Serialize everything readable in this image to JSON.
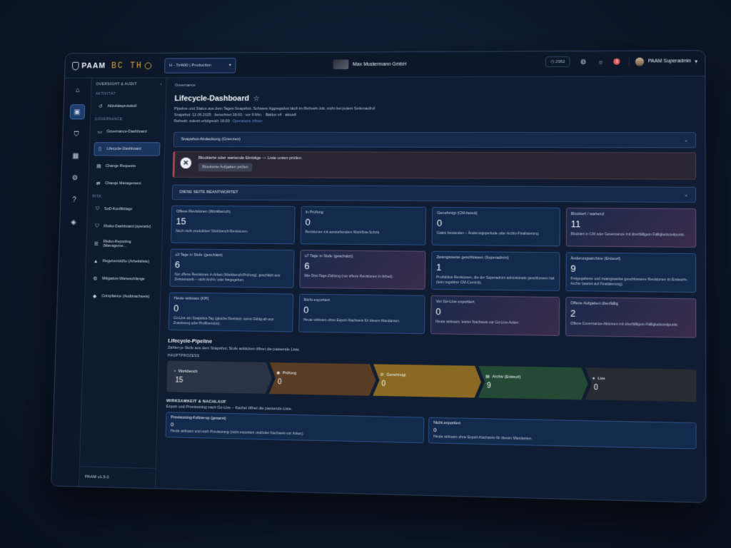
{
  "app": {
    "brand": "PAAM",
    "client_logo": "BC TH",
    "environment": "H - 7z4t00 | Production",
    "company": "Max Mustermann GmbH",
    "counter": "2952",
    "notifications": "3",
    "user": "PAAM Superadmin",
    "version": "PAAM v1.5.0"
  },
  "sidebar": {
    "header": "OVERSIGHT & AUDIT",
    "sections": [
      {
        "title": "AKTIVITÄT",
        "items": [
          {
            "label": "Aktivitätsprotokoll",
            "icon": "history-icon"
          }
        ]
      },
      {
        "title": "GOVERNANCE",
        "items": [
          {
            "label": "Governance-Dashboard",
            "icon": "monitor-icon"
          },
          {
            "label": "Lifecycle-Dashboard",
            "icon": "document-icon",
            "active": true
          },
          {
            "label": "Change Requests",
            "icon": "clipboard-icon"
          },
          {
            "label": "Change Management",
            "icon": "swap-icon"
          }
        ]
      },
      {
        "title": "RISK",
        "items": [
          {
            "label": "SoD-Konfliktlage",
            "icon": "shield-icon"
          },
          {
            "label": "Risiko-Dashboard (operativ)",
            "icon": "shield-icon"
          },
          {
            "label": "Risiko-Reporting (Manageme...",
            "icon": "list-icon"
          },
          {
            "label": "Regelverstöße (Arbeitsliste)",
            "icon": "warning-icon"
          },
          {
            "label": "Mitigation-Warteschlange",
            "icon": "gear-icon"
          },
          {
            "label": "Compliance (Auditnachweis)",
            "icon": "graduation-icon"
          }
        ]
      }
    ]
  },
  "main": {
    "breadcrumb": "Governance",
    "title": "Lifecycle-Dashboard",
    "subtitle1": "Pipeline und Status aus dem Tages-Snapshot. Schwere Aggregation läuft im Refresh-Job, nicht bei jedem Seitenaufruf.",
    "subtitle2": "Snapshot: 12.06.2025 · berechnet 16:00 · vor 9 Min. · Baldor v4 · aktuell",
    "subtitle3": "Refresh: zuletzt erfolgreich 16:00",
    "subtitle3_link": "Operations öffnen",
    "accordion1": "Snapshot-Abdeckung (Grenzen)",
    "alert_text": "Blockierte oder wartende Einträge — Liste unten prüfen.",
    "alert_button": "Blockierte Aufgaben prüfen",
    "accordion2": "DIESE SEITE BEANTWORTET",
    "kpis": [
      {
        "label": "Offene Revisionen (Workbench)",
        "value": "15",
        "desc": "Noch nicht produktiver Workbench-Revisionen.",
        "tone": "blue"
      },
      {
        "label": "In Prüfung",
        "value": "0",
        "desc": "Revisionen mit ausstehendem Workflow-Schritt.",
        "tone": "blue"
      },
      {
        "label": "Genehmigt (CM-bereit)",
        "value": "0",
        "desc": "Gates bestanden – Änderungsperiode oder Archiv-Finalisierung.",
        "tone": "blue"
      },
      {
        "label": "Blockiert / wartend",
        "value": "11",
        "desc": "Blockiert in CM oder Governance mit überfälligem Fälligkeitszeitpunkt.",
        "tone": "red"
      },
      {
        "label": "≥3 Tage in Stufe (geschätzt)",
        "value": "6",
        "desc": "Nur offene Revisionen in Arbeit (Workbench/Prüfung), geschätzt aus Zeitstempeln – nicht Archiv oder freigegeben.",
        "tone": "blue"
      },
      {
        "label": "≥7 Tage in Stufe (geschätzt)",
        "value": "6",
        "desc": "Wie Drei-Tage-Zählung (nur offene Revisionen in Arbeit).",
        "tone": "red"
      },
      {
        "label": "Zwangsweise geschlossen (Superadmin)",
        "value": "1",
        "desc": "Produktive Revisionen, die der Superadmin administrativ geschlossen hat (kein regulärer CM-Commit).",
        "tone": "blue"
      },
      {
        "label": "Änderungsarchive (Entwurf)",
        "value": "9",
        "desc": "Freigegebene und zwangsweise geschlossene Revisionen im Entwurfs-Archiv (wartet auf Finalisierung).",
        "tone": "blue"
      },
      {
        "label": "Heute wirksam (KPI)",
        "value": "0",
        "desc": "Go-Live am Snapshot-Tag (gleiche Revision; sonst Gültig-ab aus Zuweisung oder Profilversion).",
        "tone": "blue"
      },
      {
        "label": "Nicht exportiert",
        "value": "0",
        "desc": "Heute wirksam ohne Export-Nachweis für diesen Mandanten.",
        "tone": "blue"
      },
      {
        "label": "Vor Go-Live exportiert",
        "value": "0",
        "desc": "Heute wirksam; letzter Nachweis vor Go-Live-Anker.",
        "tone": "red"
      },
      {
        "label": "Offene Aufgaben überfällig",
        "value": "2",
        "desc": "Offene Governance-Aktionen mit überfälligem Fälligkeitszeitpunkt.",
        "tone": "red"
      }
    ],
    "pipeline_title": "Lifecycle-Pipeline",
    "pipeline_sub": "Zahlen je Stufe aus dem Snapshot; Stufe anklicken öffnet die passende Liste.",
    "pipeline_group": "HAUPTPROZESS",
    "pipeline": [
      {
        "label": "Workbench",
        "value": "15",
        "color": "#2a3446",
        "icon": "dot-icon",
        "glyph": "•"
      },
      {
        "label": "Prüfung",
        "value": "0",
        "color": "#5a3d24",
        "icon": "eye-icon",
        "glyph": "◉"
      },
      {
        "label": "Genehmigt",
        "value": "0",
        "color": "#8a6a22",
        "icon": "check-circle-icon",
        "glyph": "⊘"
      },
      {
        "label": "Archiv (Entwurf)",
        "value": "9",
        "color": "#244a36",
        "icon": "archive-icon",
        "glyph": "▤"
      },
      {
        "label": "Live",
        "value": "0",
        "color": "#262b34",
        "icon": "live-icon",
        "glyph": "●"
      }
    ],
    "wirk_title": "WIRKSAMKEIT & NACHLAUF",
    "wirk_sub": "Export und Provisioning nach Go-Live – Kachel öffnet die passende Liste.",
    "wirk_cards": [
      {
        "label": "Provisioning-Follow-up (gesamt)",
        "value": "0",
        "desc": "Heute wirksam und noch Provisioning (nicht exportiert und/oder Nachweis vor Anker)."
      },
      {
        "label": "Nicht exportiert",
        "value": "0",
        "desc": "Heute wirksam ohne Export-Nachweis für diesen Mandanten."
      }
    ]
  }
}
